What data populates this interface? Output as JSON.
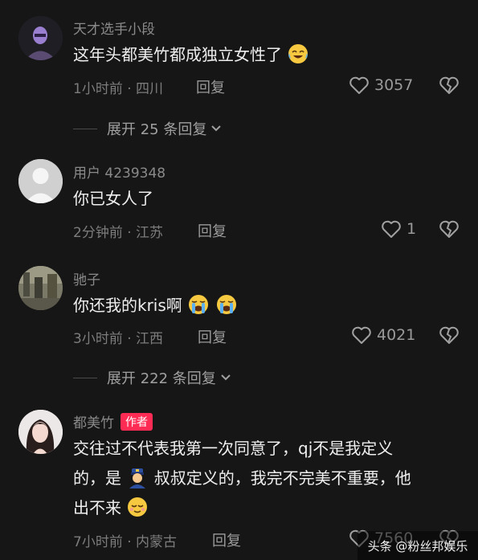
{
  "comments": [
    {
      "username": "天才选手小段",
      "text": "这年头都美竹都成独立女性了",
      "emoji": "crying-laughing-emoji",
      "meta": "1小时前 · 四川",
      "reply_label": "回复",
      "likes": "3057",
      "expand_label": "展开 25 条回复"
    },
    {
      "username": "用户 4239348",
      "text": "你已女人了",
      "meta": "2分钟前 · 江苏",
      "reply_label": "回复",
      "likes": "1"
    },
    {
      "username": "驰子",
      "text": "你还我的kris啊",
      "emoji": "loudly-crying-emoji",
      "meta": "3小时前 · 江西",
      "reply_label": "回复",
      "likes": "4021",
      "expand_label": "展开 222 条回复"
    },
    {
      "username": "都美竹",
      "badge": "作者",
      "text_line1": "交往过不代表我第一次同意了，qj不是我定义",
      "text_line2a": "的，是",
      "text_line2b": "叔叔定义的，我完不完美不重要，他",
      "text_line3": "出不来",
      "inline_emoji_1": "police-officer-emoji",
      "inline_emoji_2": "relieved-face-emoji",
      "meta": "7小时前 · 内蒙古",
      "reply_label": "回复",
      "likes": "7560"
    }
  ],
  "watermark": "头条 @粉丝邦娱乐",
  "colors": {
    "background": "#161616",
    "badge": "#fe2c55",
    "muted": "#8a8a8a"
  }
}
